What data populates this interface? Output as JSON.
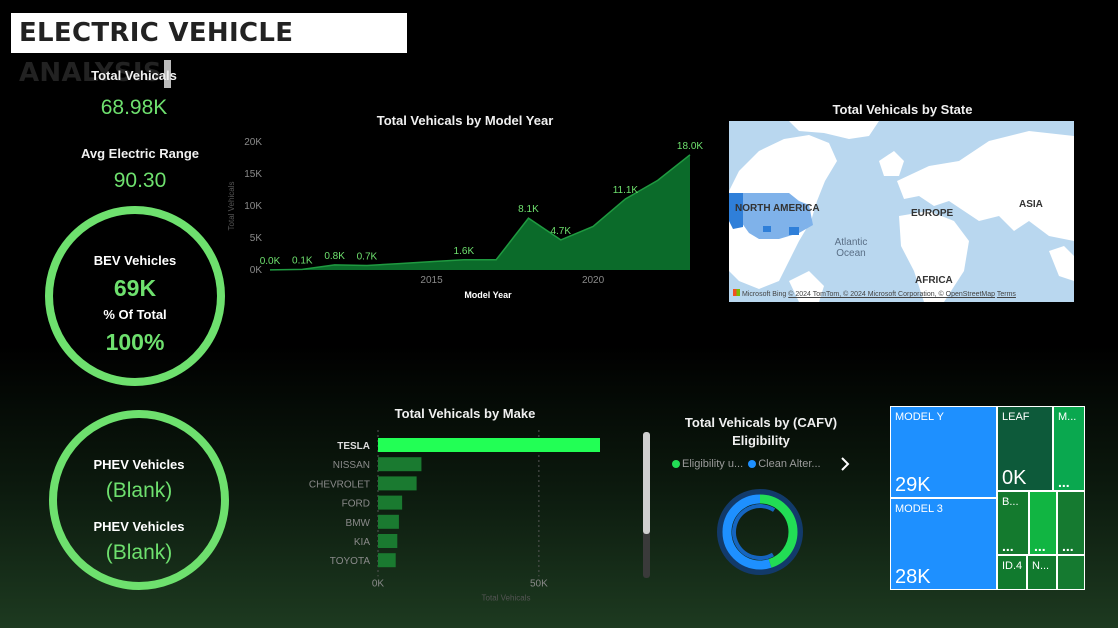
{
  "header": {
    "title": "ELECTRIC VEHICLE ANALYSIS"
  },
  "kpis": {
    "total_label": "Total Vehicals",
    "total_value": "68.98K",
    "range_label": "Avg Electric Range",
    "range_value": "90.30"
  },
  "bev_gauge": {
    "label1": "BEV Vehicles",
    "value1": "69K",
    "label2": "% Of Total",
    "value2": "100%",
    "fill_fraction": 1.0
  },
  "phev_gauge": {
    "label1": "PHEV Vehicles",
    "value1": "(Blank)",
    "label2": "PHEV Vehicles",
    "value2": "(Blank)",
    "fill_fraction": 1.0
  },
  "colors": {
    "accent": "#6ee06e",
    "area": "#0b6b2a",
    "bar_highlight": "#22ff55",
    "bar": "#1a7a30",
    "map_water": "#b9d7ef",
    "treemap_blue": "#1e90ff",
    "treemap_green": "#0aa84f"
  },
  "year_chart": {
    "title": "Total Vehicals by Model Year"
  },
  "make_chart": {
    "title": "Total Vehicals by Make"
  },
  "chart_data": [
    {
      "type": "area",
      "title": "Total Vehicals by Model Year",
      "xlabel": "Model Year",
      "ylabel": "Total Vehicals",
      "x": [
        2010,
        2011,
        2012,
        2013,
        2014,
        2015,
        2016,
        2017,
        2018,
        2019,
        2020,
        2021,
        2022,
        2023
      ],
      "values": [
        20,
        100,
        800,
        700,
        1000,
        1300,
        1600,
        1600,
        8100,
        4700,
        6800,
        11100,
        14000,
        18000
      ],
      "data_labels": [
        {
          "x": 2010,
          "text": "0.0K"
        },
        {
          "x": 2011,
          "text": "0.1K"
        },
        {
          "x": 2012,
          "text": "0.8K"
        },
        {
          "x": 2013,
          "text": "0.7K"
        },
        {
          "x": 2016,
          "text": "1.6K"
        },
        {
          "x": 2018,
          "text": "8.1K"
        },
        {
          "x": 2019,
          "text": "4.7K"
        },
        {
          "x": 2021,
          "text": "11.1K"
        },
        {
          "x": 2023,
          "text": "18.0K"
        }
      ],
      "x_ticks": [
        "2015",
        "2020"
      ],
      "y_ticks": [
        "0K",
        "5K",
        "10K",
        "15K",
        "20K"
      ],
      "ylim": [
        0,
        20000
      ],
      "grid": false
    },
    {
      "type": "bar",
      "orientation": "horizontal",
      "title": "Total Vehicals by Make",
      "xlabel": "Total Vehicals",
      "categories": [
        "TESLA",
        "NISSAN",
        "CHEVROLET",
        "FORD",
        "BMW",
        "KIA",
        "TOYOTA"
      ],
      "values": [
        69000,
        13500,
        12000,
        7500,
        6500,
        6000,
        5500
      ],
      "x_ticks": [
        "0K",
        "50K"
      ],
      "xlim": [
        0,
        69000
      ],
      "grid": true
    },
    {
      "type": "pie",
      "title": "Total Vehicals by (CAFV) Eligibility",
      "categories": [
        "Eligibility u...",
        "Clean Alter..."
      ],
      "values": [
        45,
        55
      ],
      "legend_position": "top"
    }
  ],
  "map": {
    "title": "Total Vehicals by State",
    "labels": {
      "north_america": "NORTH AMERICA",
      "europe": "EUROPE",
      "asia": "ASIA",
      "africa": "AFRICA",
      "ocean": "Atlantic Ocean"
    },
    "footer": {
      "brand": "Microsoft Bing",
      "copy": "© 2024 TomTom, © 2024 Microsoft Corporation, © OpenStreetMap",
      "terms": "Terms"
    }
  },
  "cafv": {
    "title": "Total Vehicals by (CAFV) Eligibility",
    "legend": [
      {
        "label": "Eligibility u...",
        "color": "#22dd55"
      },
      {
        "label": "Clean Alter...",
        "color": "#1e90ff"
      }
    ],
    "next_icon": "chevron-right-icon"
  },
  "treemap": {
    "cells": [
      {
        "name": "MODEL Y",
        "value": "29K",
        "color": "#1e90ff"
      },
      {
        "name": "MODEL 3",
        "value": "28K",
        "color": "#1e90ff"
      },
      {
        "name": "LEAF",
        "value": "0K",
        "color": "#0d5a3a"
      },
      {
        "name": "M...",
        "value": "...",
        "color": "#0aa84f"
      },
      {
        "name": "B...",
        "value": "...",
        "color": "#147a2e"
      },
      {
        "name": "",
        "value": "...",
        "color": "#11b542"
      },
      {
        "name": "",
        "value": "...",
        "color": "#157a30"
      },
      {
        "name": "ID.4",
        "value": "",
        "color": "#117a2e"
      },
      {
        "name": "N...",
        "value": "",
        "color": "#117a2e"
      }
    ]
  }
}
